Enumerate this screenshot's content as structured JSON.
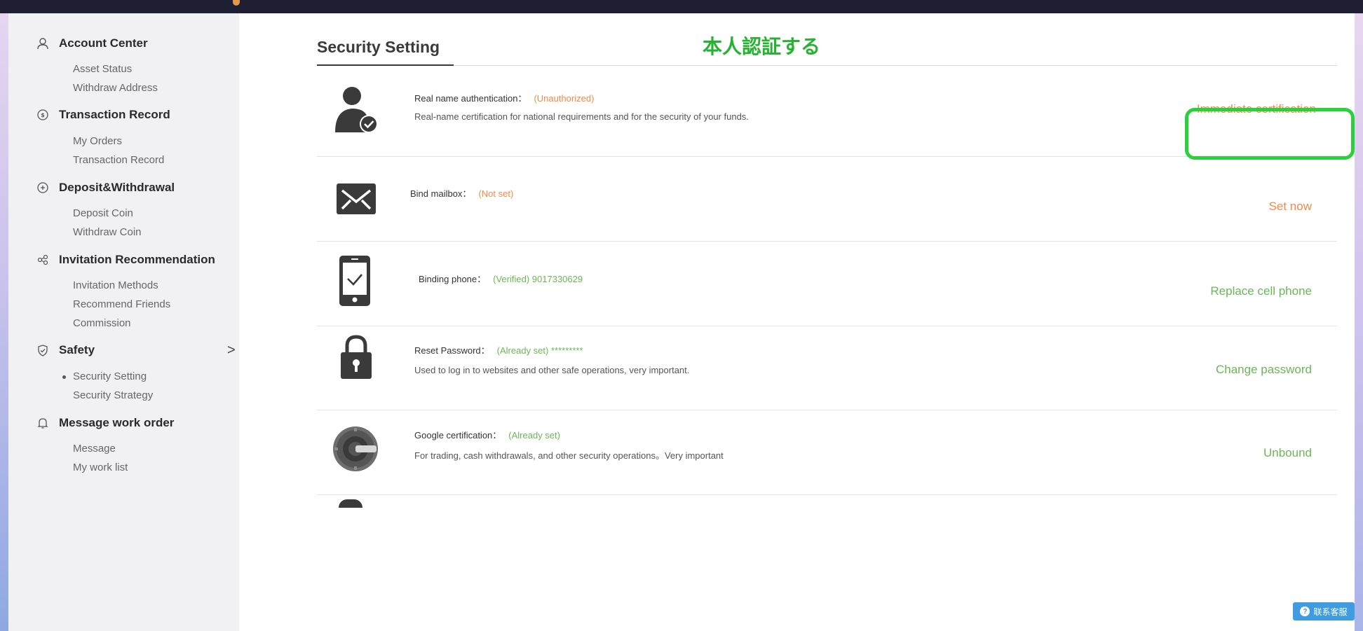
{
  "sidebar": {
    "groups": [
      {
        "title": "Account Center",
        "icon": "user-icon",
        "items": [
          "Asset Status",
          "Withdraw Address"
        ]
      },
      {
        "title": "Transaction Record",
        "icon": "coin-circle-icon",
        "items": [
          "My Orders",
          "Transaction Record"
        ]
      },
      {
        "title": "Deposit&Withdrawal",
        "icon": "deposit-circle-icon",
        "items": [
          "Deposit Coin",
          "Withdraw Coin"
        ]
      },
      {
        "title": "Invitation Recommendation",
        "icon": "share-icon",
        "items": [
          "Invitation Methods",
          "Recommend Friends",
          "Commission"
        ]
      },
      {
        "title": "Safety",
        "icon": "shield-icon",
        "chevron": ">",
        "items": [
          "Security Setting",
          "Security Strategy"
        ],
        "active_item": "Security Setting"
      },
      {
        "title": "Message work order",
        "icon": "bell-icon",
        "items": [
          "Message",
          "My work list"
        ]
      }
    ]
  },
  "main": {
    "title": "Security Setting",
    "annotation": "本人認証する",
    "rows": [
      {
        "label": "Real name authentication：",
        "status": "(Unauthorized)",
        "status_color": "#ef8a4a",
        "value": "",
        "desc": "Real-name certification for national requirements and for the security of your funds.",
        "action": "Immediate certification",
        "action_color": "#ef8a4a",
        "icon": "user-check-icon"
      },
      {
        "label": "Bind mailbox：",
        "status": "(Not set)",
        "status_color": "#ef8a4a",
        "value": "",
        "desc": "",
        "action": "Set now",
        "action_color": "#ef8a4a",
        "icon": "envelope-icon"
      },
      {
        "label": "Binding phone：",
        "status": "(Verified)",
        "status_color": "#6cb558",
        "value": "9017330629",
        "desc": "",
        "action": "Replace cell phone",
        "action_color": "#6cb558",
        "icon": "phone-check-icon"
      },
      {
        "label": "Reset Password：",
        "status": "(Already set)",
        "status_color": "#6cb558",
        "value": "*********",
        "desc": "Used to log in to websites and other safe operations, very important.",
        "action": "Change password",
        "action_color": "#6cb558",
        "icon": "lock-icon"
      },
      {
        "label": "Google certification：",
        "status": "(Already set)",
        "status_color": "#6cb558",
        "value": "",
        "desc": "For trading, cash withdrawals, and other security operations。Very important",
        "action": "Unbound",
        "action_color": "#6cb558",
        "icon": "google-authenticator-icon"
      }
    ]
  },
  "support": {
    "label": "联系客服",
    "icon": "chat-icon"
  },
  "colors": {
    "accent_orange": "#ef8a4a",
    "accent_green": "#6cb558",
    "highlight": "#2bd13a",
    "annotation": "#28b233"
  }
}
